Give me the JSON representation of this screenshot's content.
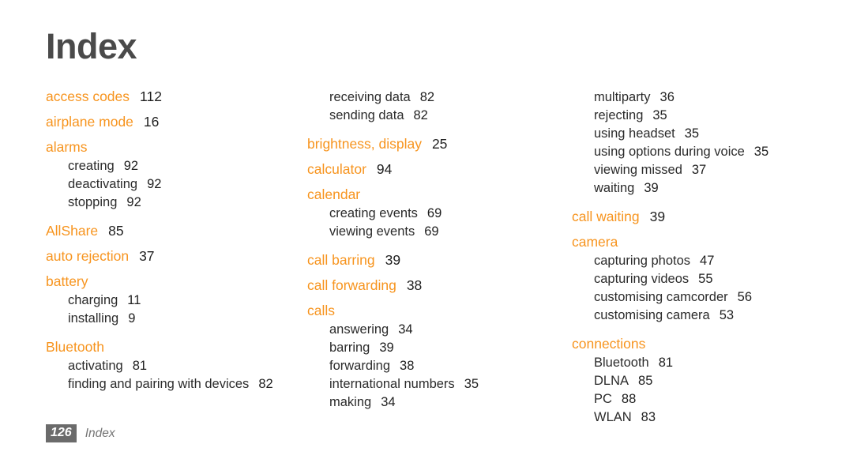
{
  "page": {
    "title": "Index",
    "accent_color": "#F7941E",
    "title_color": "#4a4a4a",
    "text_color": "#2b2b2b",
    "background_color": "#ffffff"
  },
  "footer": {
    "page_number": "126",
    "section_label": "Index",
    "badge_color": "#6b6b6b"
  },
  "columns": [
    {
      "id": "column-1",
      "entries": [
        {
          "type": "main",
          "label": "access codes",
          "page": "112"
        },
        {
          "type": "main",
          "label": "airplane mode",
          "page": "16"
        },
        {
          "type": "main",
          "label": "alarms",
          "page": ""
        },
        {
          "type": "sub",
          "label": "creating",
          "page": "92"
        },
        {
          "type": "sub",
          "label": "deactivating",
          "page": "92"
        },
        {
          "type": "sub",
          "label": "stopping",
          "page": "92"
        },
        {
          "type": "main",
          "label": "AllShare",
          "page": "85"
        },
        {
          "type": "main",
          "label": "auto rejection",
          "page": "37"
        },
        {
          "type": "main",
          "label": "battery",
          "page": ""
        },
        {
          "type": "sub",
          "label": "charging",
          "page": "11"
        },
        {
          "type": "sub",
          "label": "installing",
          "page": "9"
        },
        {
          "type": "main",
          "label": "Bluetooth",
          "page": ""
        },
        {
          "type": "sub",
          "label": "activating",
          "page": "81"
        },
        {
          "type": "sub",
          "label": "finding and pairing with devices",
          "page": "82"
        }
      ]
    },
    {
      "id": "column-2",
      "entries": [
        {
          "type": "sub",
          "label": "receiving data",
          "page": "82"
        },
        {
          "type": "sub",
          "label": "sending data",
          "page": "82"
        },
        {
          "type": "main",
          "label": "brightness, display",
          "page": "25"
        },
        {
          "type": "main",
          "label": "calculator",
          "page": "94"
        },
        {
          "type": "main",
          "label": "calendar",
          "page": ""
        },
        {
          "type": "sub",
          "label": "creating events",
          "page": "69"
        },
        {
          "type": "sub",
          "label": "viewing events",
          "page": "69"
        },
        {
          "type": "main",
          "label": "call barring",
          "page": "39"
        },
        {
          "type": "main",
          "label": "call forwarding",
          "page": "38"
        },
        {
          "type": "main",
          "label": "calls",
          "page": ""
        },
        {
          "type": "sub",
          "label": "answering",
          "page": "34"
        },
        {
          "type": "sub",
          "label": "barring",
          "page": "39"
        },
        {
          "type": "sub",
          "label": "forwarding",
          "page": "38"
        },
        {
          "type": "sub",
          "label": "international numbers",
          "page": "35"
        },
        {
          "type": "sub",
          "label": "making",
          "page": "34"
        }
      ]
    },
    {
      "id": "column-3",
      "entries": [
        {
          "type": "sub",
          "label": "multiparty",
          "page": "36"
        },
        {
          "type": "sub",
          "label": "rejecting",
          "page": "35"
        },
        {
          "type": "sub",
          "label": "using headset",
          "page": "35"
        },
        {
          "type": "sub",
          "label": "using options during voice",
          "page": "35"
        },
        {
          "type": "sub",
          "label": "viewing missed",
          "page": "37"
        },
        {
          "type": "sub",
          "label": "waiting",
          "page": "39"
        },
        {
          "type": "main",
          "label": "call waiting",
          "page": "39"
        },
        {
          "type": "main",
          "label": "camera",
          "page": ""
        },
        {
          "type": "sub",
          "label": "capturing photos",
          "page": "47"
        },
        {
          "type": "sub",
          "label": "capturing videos",
          "page": "55"
        },
        {
          "type": "sub",
          "label": "customising camcorder",
          "page": "56"
        },
        {
          "type": "sub",
          "label": "customising camera",
          "page": "53"
        },
        {
          "type": "main",
          "label": "connections",
          "page": ""
        },
        {
          "type": "sub",
          "label": "Bluetooth",
          "page": "81"
        },
        {
          "type": "sub",
          "label": "DLNA",
          "page": "85"
        },
        {
          "type": "sub",
          "label": "PC",
          "page": "88"
        },
        {
          "type": "sub",
          "label": "WLAN",
          "page": "83"
        }
      ]
    }
  ]
}
